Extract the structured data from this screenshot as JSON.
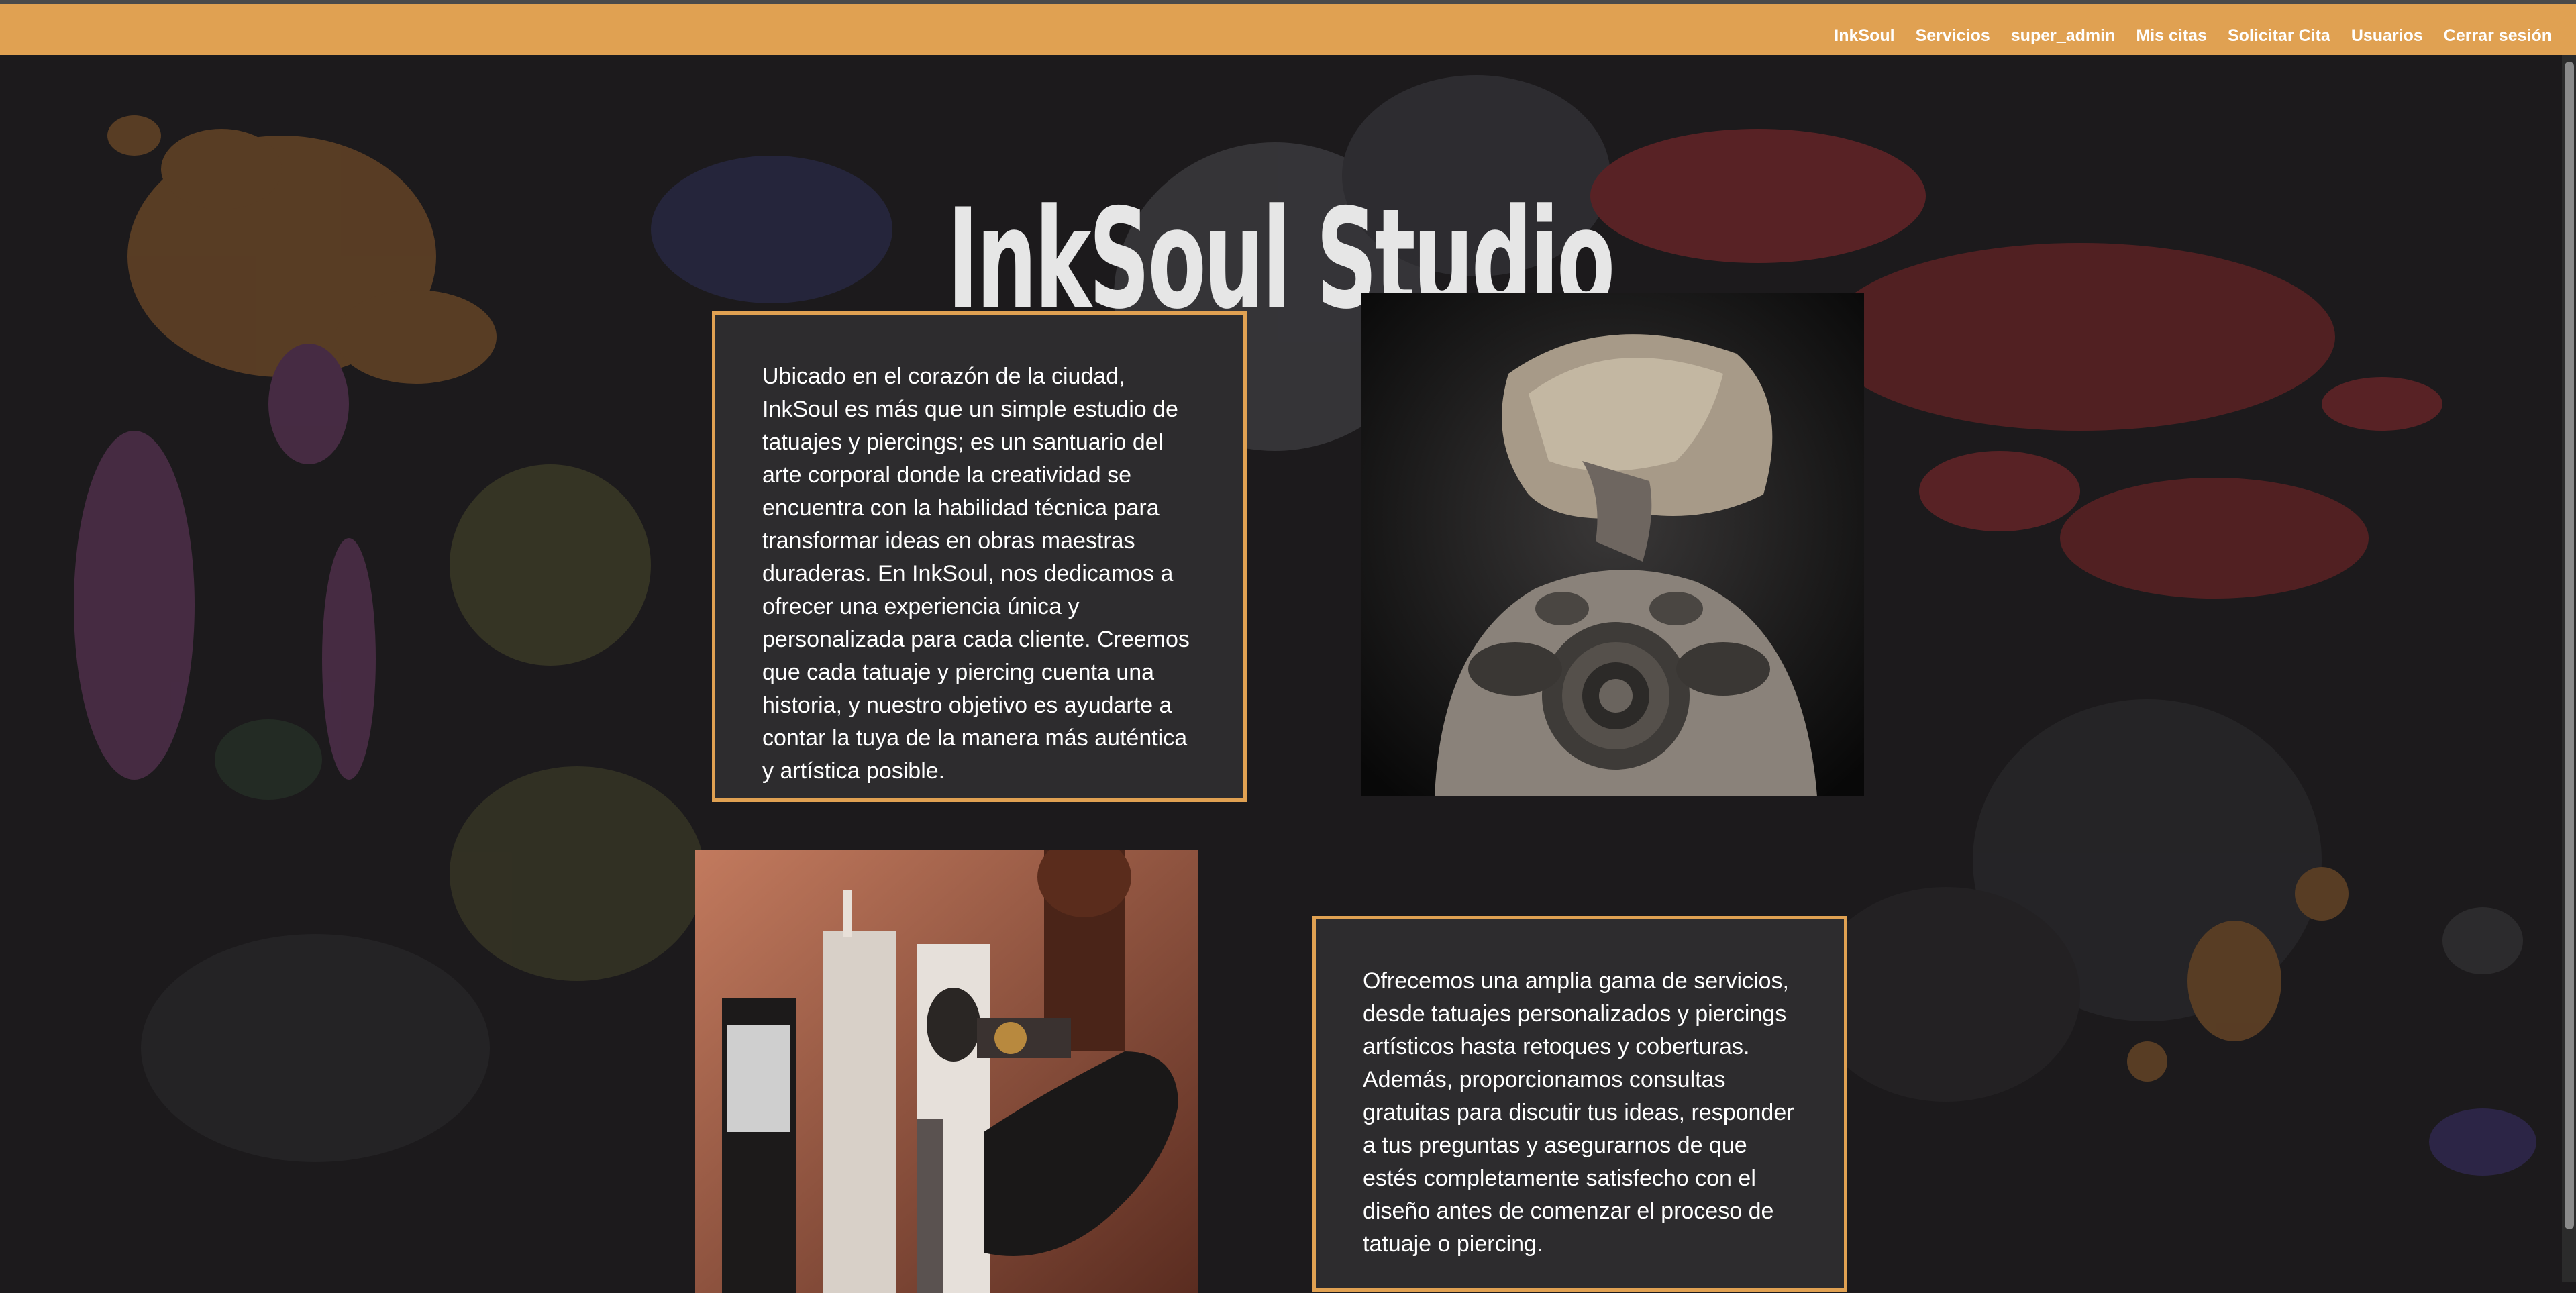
{
  "navbar": {
    "items": [
      {
        "label": "InkSoul"
      },
      {
        "label": "Servicios"
      },
      {
        "label": "super_admin"
      },
      {
        "label": "Mis citas"
      },
      {
        "label": "Solicitar Cita"
      },
      {
        "label": "Usuarios"
      },
      {
        "label": "Cerrar sesión"
      }
    ]
  },
  "hero": {
    "title": "InkSoul Studio"
  },
  "sections": [
    {
      "text": "Ubicado en el corazón de la ciudad, InkSoul es más que un simple estudio de tatuajes y piercings; es un santuario del arte corporal donde la creatividad se encuentra con la habilidad técnica para transformar ideas en obras maestras duraderas. En InkSoul, nos dedicamos a ofrecer una experiencia única y personalizada para cada cliente. Creemos que cada tatuaje y piercing cuenta una historia, y nuestro objetivo es ayudarte a contar la tuya de la manera más auténtica y artística posible."
    },
    {
      "text": "Ofrecemos una amplia gama de servicios, desde tatuajes personalizados y piercings artísticos hasta retoques y coberturas. Además, proporcionamos consultas gratuitas para discutir tus ideas, responder a tus preguntas y asegurarnos de que estés completamente satisfecho con el diseño antes de comenzar el proceso de tatuaje o piercing."
    }
  ],
  "colors": {
    "accent": "#e0a152",
    "background": "#1c1a1c",
    "card": "#2d2c2e",
    "title": "#e6e6e6"
  }
}
